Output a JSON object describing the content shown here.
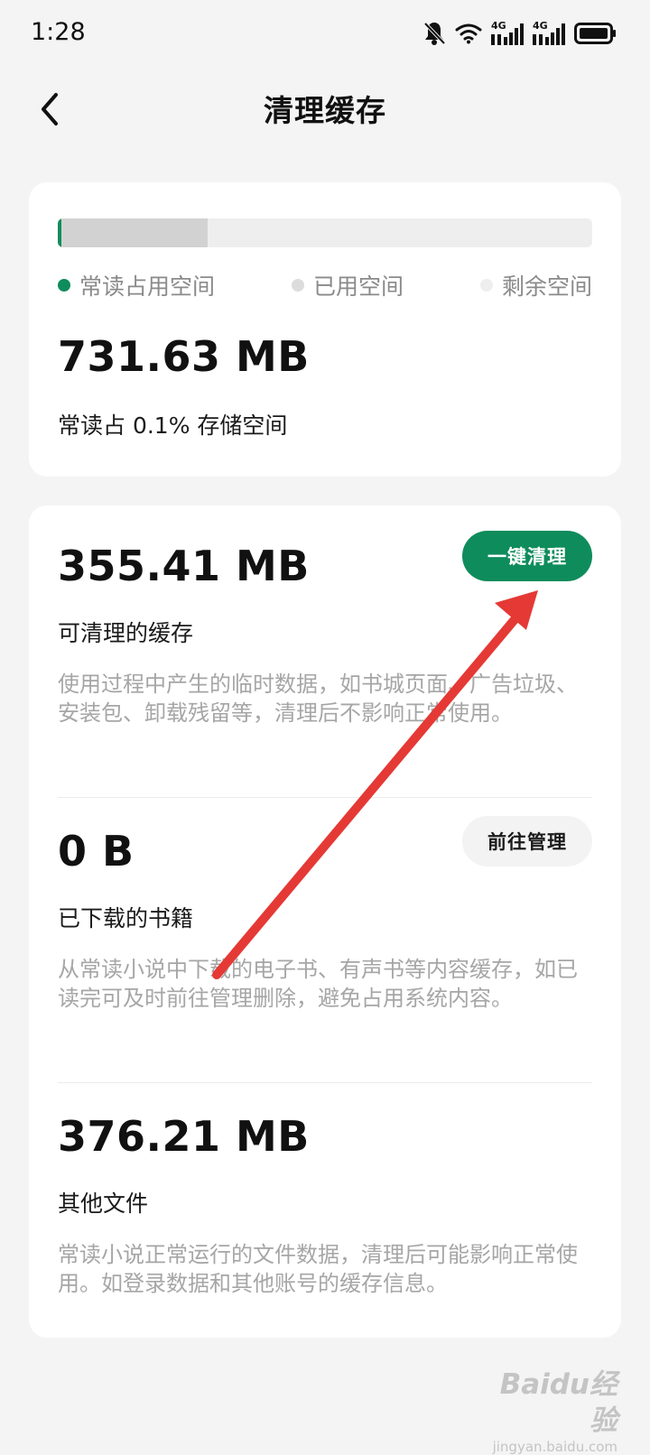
{
  "status_bar": {
    "time": "1:28",
    "signal_1_label": "4G",
    "signal_2_label": "4G",
    "icons": [
      "bell-muted-icon",
      "wifi-icon",
      "signal-icon",
      "signal-icon",
      "battery-icon"
    ]
  },
  "header": {
    "title": "清理缓存",
    "back_icon": "chevron-left-icon"
  },
  "storage": {
    "legend": {
      "app": "常读占用空间",
      "used": "已用空间",
      "free": "剩余空间"
    },
    "app_fraction": 0.007,
    "used_fraction": 0.28,
    "total_size": "731.63 MB",
    "total_desc": "常读占 0.1% 存储空间"
  },
  "sections": [
    {
      "size": "355.41 MB",
      "label": "可清理的缓存",
      "desc": "使用过程中产生的临时数据，如书城页面、广告垃圾、安装包、卸载残留等，清理后不影响正常使用。",
      "button": "一键清理"
    },
    {
      "size": "0 B",
      "label": "已下载的书籍",
      "desc": "从常读小说中下载的电子书、有声书等内容缓存，如已读完可及时前往管理删除，避免占用系统内容。",
      "button": "前往管理"
    },
    {
      "size": "376.21 MB",
      "label": "其他文件",
      "desc": "常读小说正常运行的文件数据，清理后可能影响正常使用。如登录数据和其他账号的缓存信息。"
    }
  ],
  "watermark": {
    "logo": "Baidu经验",
    "sub": "jingyan.baidu.com"
  },
  "colors": {
    "accent": "#0f8c5c",
    "used": "#d2d2d2",
    "free": "#eeeeee",
    "annotation_arrow": "#e53935"
  }
}
